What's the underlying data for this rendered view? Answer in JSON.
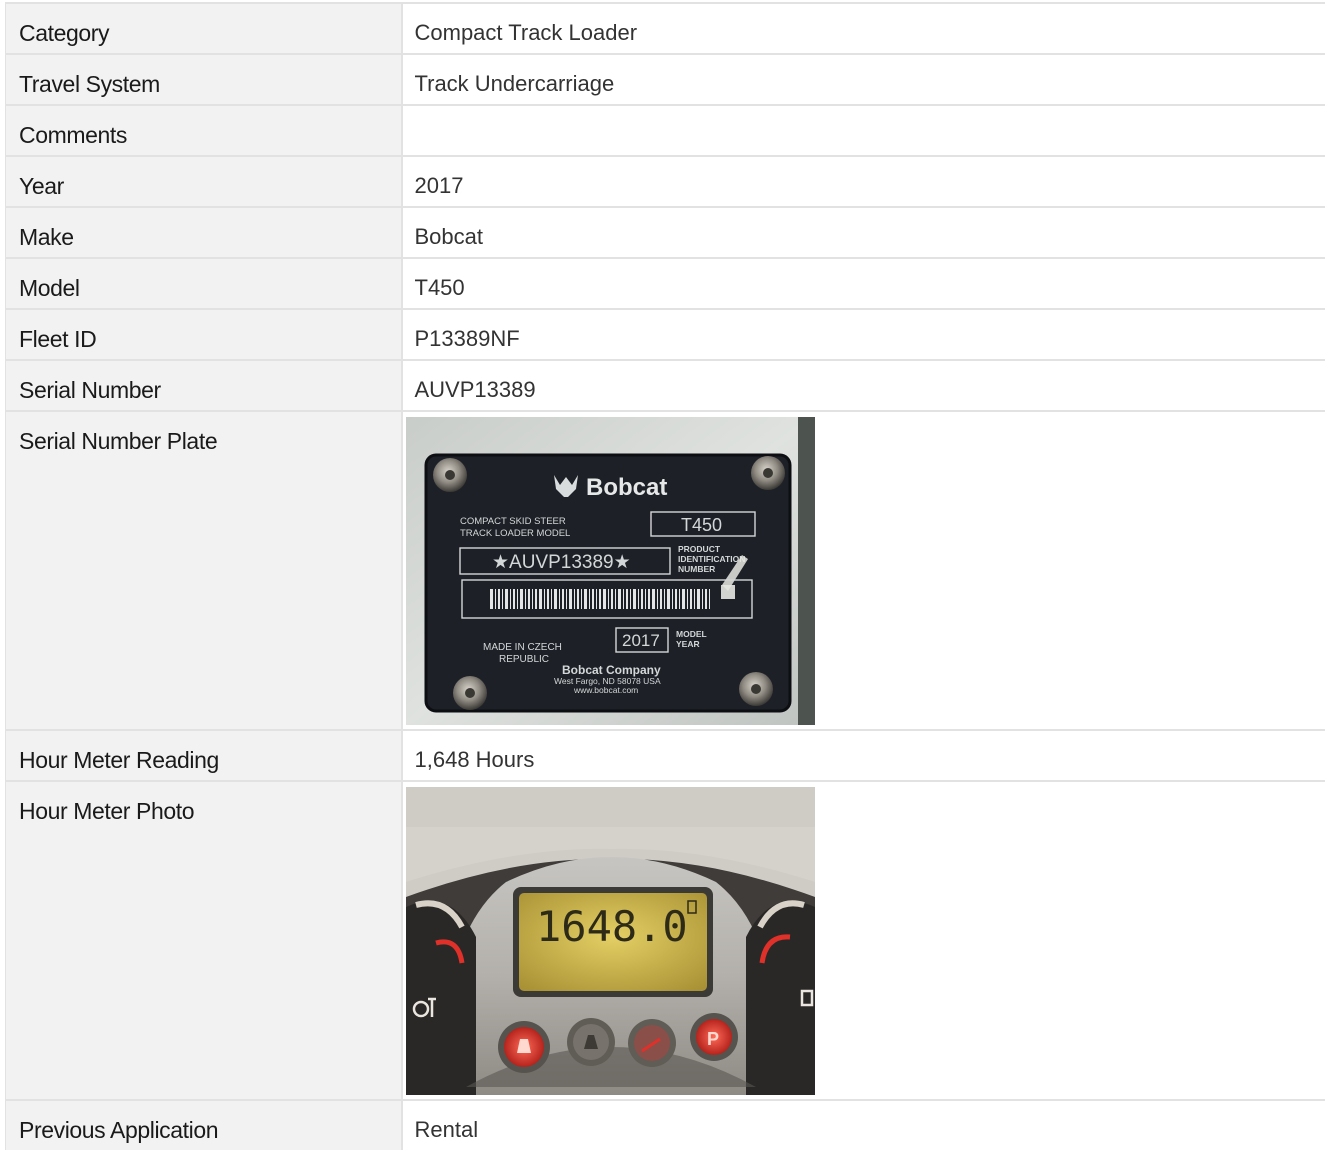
{
  "specs": {
    "category": {
      "label": "Category",
      "value": "Compact Track Loader"
    },
    "travel_system": {
      "label": "Travel System",
      "value": "Track Undercarriage"
    },
    "comments": {
      "label": "Comments",
      "value": ""
    },
    "year": {
      "label": "Year",
      "value": "2017"
    },
    "make": {
      "label": "Make",
      "value": "Bobcat"
    },
    "model": {
      "label": "Model",
      "value": "T450"
    },
    "fleet_id": {
      "label": "Fleet ID",
      "value": "P13389NF"
    },
    "serial_number": {
      "label": "Serial Number",
      "value": "AUVP13389"
    },
    "serial_plate": {
      "label": "Serial Number Plate",
      "photo": {
        "brand": "Bobcat",
        "model_label": "COMPACT SKID STEER",
        "model_label2": "TRACK LOADER MODEL",
        "model": "T450",
        "pin": "★AUVP13389★",
        "pin_label": "PRODUCT",
        "pin_label2": "IDENTIFICATION",
        "pin_label3": "NUMBER",
        "made_in": "MADE IN CZECH",
        "made_in2": "REPUBLIC",
        "year": "2017",
        "year_label": "MODEL",
        "year_label2": "YEAR",
        "company": "Bobcat Company",
        "address": "West Fargo, ND 58078 USA",
        "website": "www.bobcat.com"
      }
    },
    "hour_meter_reading": {
      "label": "Hour Meter Reading",
      "value": "1,648 Hours"
    },
    "hour_meter_photo": {
      "label": "Hour Meter Photo",
      "photo": {
        "display": "1648.0"
      }
    },
    "previous_application": {
      "label": "Previous Application",
      "value": "Rental"
    }
  },
  "colors": {
    "label_bg": "#f2f2f2",
    "border": "#e2e2e2",
    "plate_bg": "#1d2127",
    "lcd_bg": "#c9b44a",
    "warning_red": "#e0302a"
  }
}
